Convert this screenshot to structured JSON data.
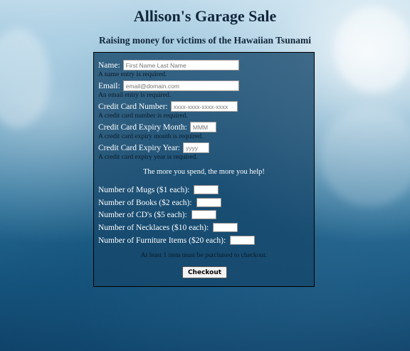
{
  "page": {
    "title": "Allison's Garage Sale",
    "subtitle": "Raising money for victims of the Hawaiian Tsunami"
  },
  "form": {
    "name": {
      "label": "Name:",
      "placeholder": "First Name Last Name",
      "value": "",
      "error": "A name entry is required."
    },
    "email": {
      "label": "Email:",
      "placeholder": "email@domain.com",
      "value": "",
      "error": "An email entry is required."
    },
    "card_number": {
      "label": "Credit Card Number:",
      "placeholder": "xxxx-xxxx-xxxx-xxxx",
      "value": "",
      "error": "A credit card number is required."
    },
    "expiry_month": {
      "label": "Credit Card Expiry Month:",
      "placeholder": "MMM",
      "value": "",
      "error": "A credit card expiry month is required."
    },
    "expiry_year": {
      "label": "Credit Card Expiry Year:",
      "placeholder": "yyyy",
      "value": "",
      "error": "A credit card expiry year is required."
    },
    "spend_message": "The more you spend, the more you help!",
    "items": [
      {
        "label": "Number of Mugs ($1 each):",
        "value": ""
      },
      {
        "label": "Number of Books ($2 each):",
        "value": ""
      },
      {
        "label": "Number of CD's ($5 each):",
        "value": ""
      },
      {
        "label": "Number of Necklaces ($10 each):",
        "value": ""
      },
      {
        "label": "Number of Furniture Items ($20 each):",
        "value": ""
      }
    ],
    "items_error": "At least 1 item must be purchased to checkout.",
    "checkout_label": "Checkout"
  },
  "colors": {
    "panel": "#16466a",
    "title": "#11263a",
    "error_text": "#0b1b28"
  }
}
